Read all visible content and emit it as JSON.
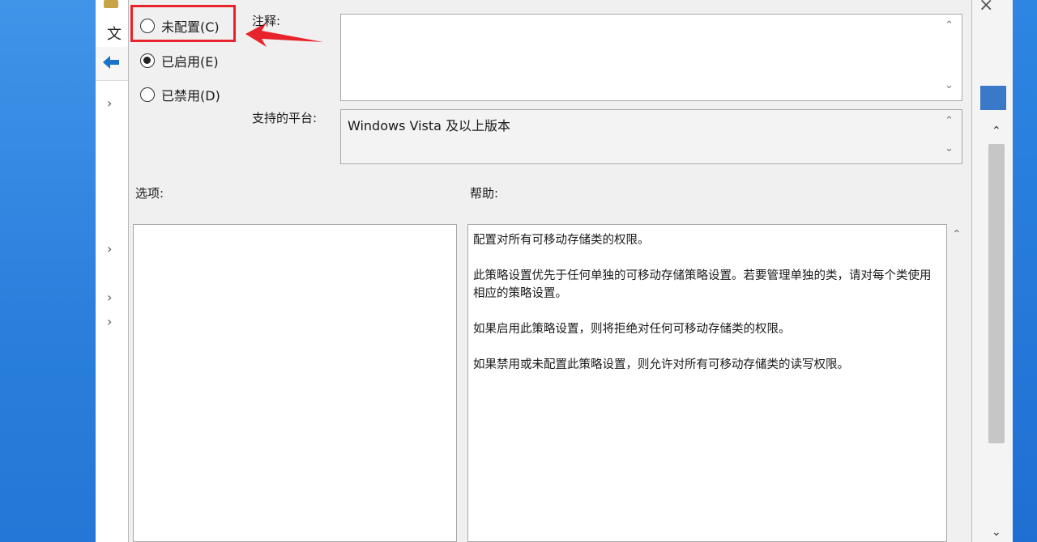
{
  "background_window": {
    "menu_partial": "文",
    "tree_chevron": "›"
  },
  "dialog": {
    "radios": [
      {
        "label": "未配置(C)",
        "checked": false
      },
      {
        "label": "已启用(E)",
        "checked": true
      },
      {
        "label": "已禁用(D)",
        "checked": false
      }
    ],
    "comment_label": "注释:",
    "comment_value": "",
    "platform_label": "支持的平台:",
    "platform_value": "Windows Vista 及以上版本",
    "options_label": "选项:",
    "help_label": "帮助:",
    "help_paragraphs": [
      "配置对所有可移动存储类的权限。",
      "此策略设置优先于任何单独的可移动存储策略设置。若要管理单独的类，请对每个类使用相应的策略设置。",
      "如果启用此策略设置，则将拒绝对任何可移动存储类的权限。",
      "如果禁用或未配置此策略设置，则允许对所有可移动存储类的读写权限。"
    ]
  },
  "annotation": {
    "highlight_color": "#e8232b"
  },
  "colors": {
    "accent_blue": "#1e6fd0"
  }
}
